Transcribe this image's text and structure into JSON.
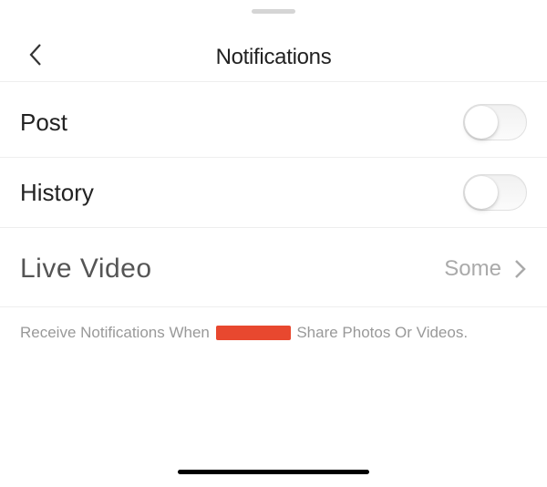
{
  "header": {
    "title": "Notifications"
  },
  "rows": {
    "post": {
      "label": "Post",
      "enabled": false
    },
    "history": {
      "label": "History",
      "enabled": false
    },
    "live": {
      "label": "Live Video",
      "value": "Some"
    }
  },
  "footer": {
    "prefix": "Receive Notifications When ",
    "suffix": " Share Photos Or Videos."
  }
}
